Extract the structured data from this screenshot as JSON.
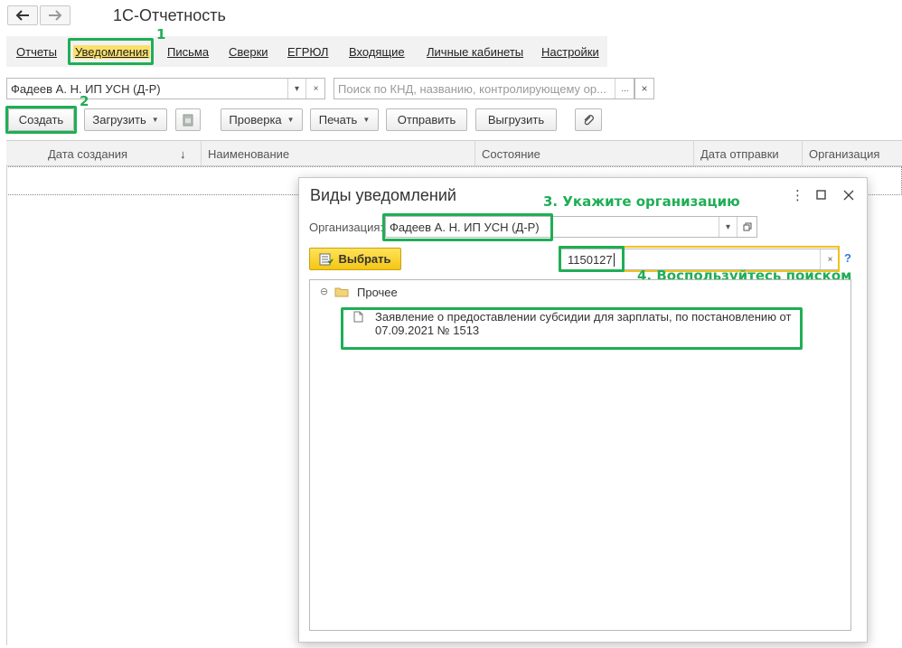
{
  "app": {
    "title": "1С-Отчетность",
    "back_icon": "arrow-left-icon",
    "forward_icon": "arrow-right-icon"
  },
  "tabs": [
    {
      "label": "Отчеты"
    },
    {
      "label": "Уведомления",
      "active": true
    },
    {
      "label": "Письма"
    },
    {
      "label": "Сверки"
    },
    {
      "label": "ЕГРЮЛ"
    },
    {
      "label": "Входящие"
    },
    {
      "label": "Личные кабинеты"
    },
    {
      "label": "Настройки"
    }
  ],
  "filter": {
    "organization_value": "Фадеев А. Н. ИП УСН (Д-Р)",
    "search_placeholder": "Поиск по КНД, названию, контролирующему ор...",
    "more_label": "...",
    "clear_label": "×",
    "dropdown_label": "▾"
  },
  "toolbar": {
    "create": "Создать",
    "upload": "Загрузить",
    "check": "Проверка",
    "print": "Печать",
    "send": "Отправить",
    "export": "Выгрузить"
  },
  "table": {
    "columns": [
      "Дата создания",
      "Наименование",
      "Состояние",
      "Дата отправки",
      "Организация"
    ],
    "sort_indicator": "↓"
  },
  "annotations": {
    "step1": "1",
    "step2": "2",
    "step3": "3. Укажите организацию",
    "step4": "4. Воспользуйтесь поиском"
  },
  "dialog": {
    "title": "Виды уведомлений",
    "org_label": "Организация:",
    "org_value": "Фадеев А. Н. ИП УСН (Д-Р)",
    "select_button": "Выбрать",
    "search_value": "1150127",
    "help": "?",
    "clear": "×",
    "tree": {
      "group_label": "Прочее",
      "collapse_glyph": "⊖",
      "item_line1": "Заявление о предоставлении субсидии для зарплаты, по постановлению от",
      "item_line2": "07.09.2021 № 1513"
    }
  },
  "colors": {
    "accent_green": "#1fae55",
    "active_tab": "#fbe06b",
    "search_highlight": "#f0c21b",
    "select_button": "#f4c614"
  }
}
